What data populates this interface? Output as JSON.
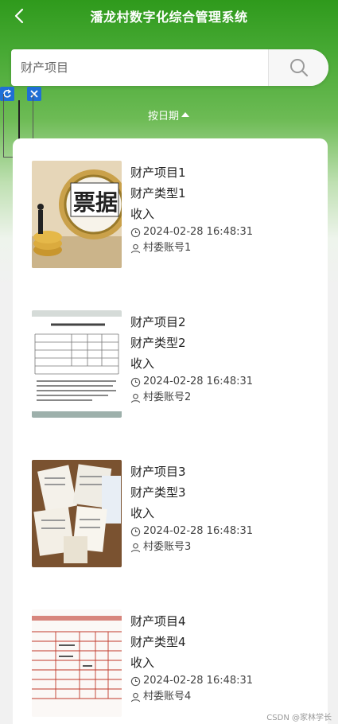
{
  "header": {
    "title": "潘龙村数字化综合管理系统",
    "back_icon": "chevron-left-icon"
  },
  "search": {
    "placeholder": "财产项目",
    "value": "",
    "button_icon": "search-icon"
  },
  "sort": {
    "label": "按日期",
    "direction_icon": "caret-up-icon"
  },
  "items": [
    {
      "name": "财产项目1",
      "type": "财产类型1",
      "category": "收入",
      "time": "2024-02-28 16:48:31",
      "account": "村委账号1",
      "thumb": "bill-coins-photo"
    },
    {
      "name": "财产项目2",
      "type": "财产类型2",
      "category": "收入",
      "time": "2024-02-28 16:48:31",
      "account": "村委账号2",
      "thumb": "invoice-form-photo"
    },
    {
      "name": "财产项目3",
      "type": "财产类型3",
      "category": "收入",
      "time": "2024-02-28 16:48:31",
      "account": "村委账号3",
      "thumb": "receipts-pile-photo"
    },
    {
      "name": "财产项目4",
      "type": "财产类型4",
      "category": "收入",
      "time": "2024-02-28 16:48:31",
      "account": "村委账号4",
      "thumb": "red-ledger-photo"
    }
  ],
  "watermark": "CSDN @家林学长",
  "colors": {
    "brand_green": "#2f9a1c",
    "tool_blue": "#1f6fd6"
  }
}
